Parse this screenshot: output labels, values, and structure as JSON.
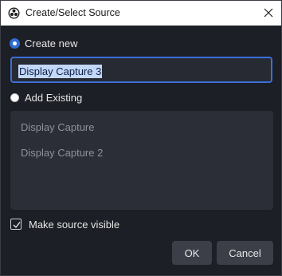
{
  "window": {
    "title": "Create/Select Source",
    "icon": "obs-logo-icon",
    "close_icon": "close-icon"
  },
  "options": {
    "create_new_label": "Create new",
    "create_new_selected": true,
    "add_existing_label": "Add Existing",
    "add_existing_selected": false
  },
  "name_field": {
    "value": "Display Capture 3"
  },
  "existing_sources": [
    "Display Capture",
    "Display Capture 2"
  ],
  "visibility": {
    "label": "Make source visible",
    "checked": true
  },
  "buttons": {
    "ok_label": "OK",
    "cancel_label": "Cancel"
  },
  "colors": {
    "background": "#1d1f26",
    "accent": "#3b6fd8",
    "panel": "#2b2e37",
    "button": "#3c3f48"
  }
}
